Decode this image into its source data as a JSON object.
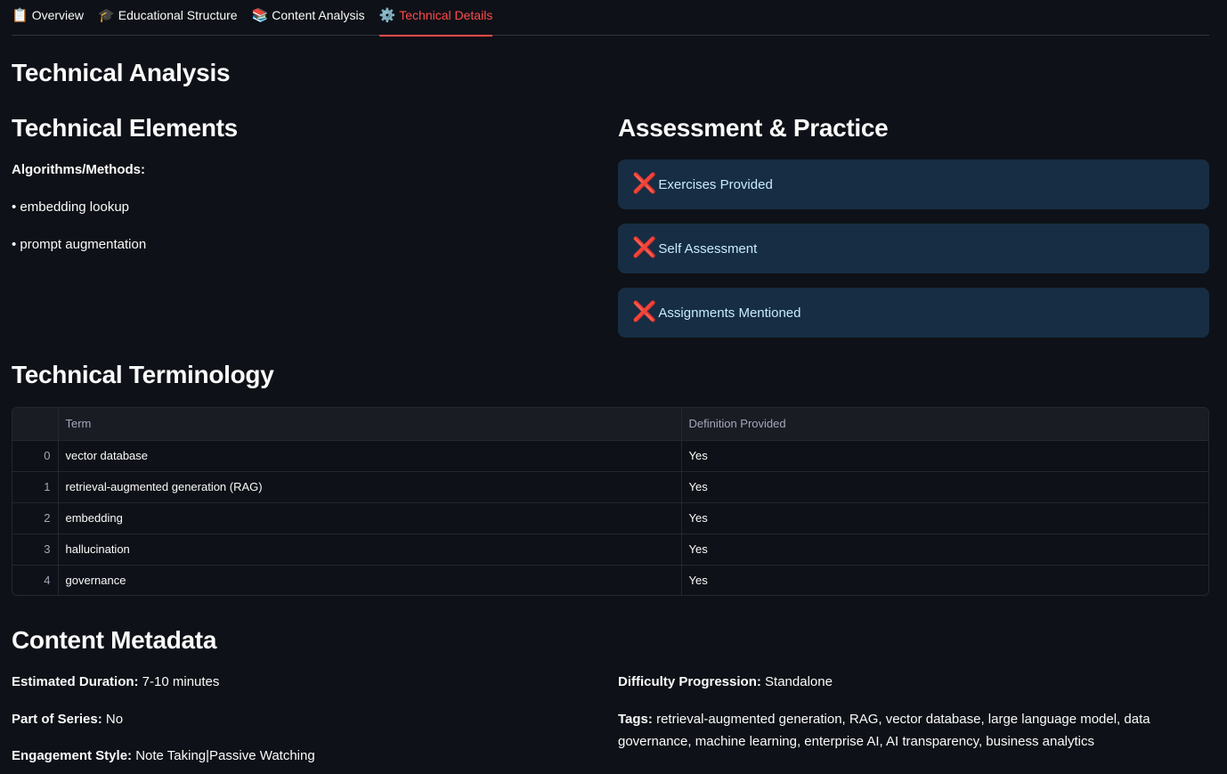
{
  "tabs": [
    {
      "icon": "📋",
      "icon_name": "clipboard-icon",
      "label": "Overview",
      "active": false
    },
    {
      "icon": "🎓",
      "icon_name": "graduation-cap-icon",
      "label": "Educational Structure",
      "active": false
    },
    {
      "icon": "📚",
      "icon_name": "books-icon",
      "label": "Content Analysis",
      "active": false
    },
    {
      "icon": "⚙️",
      "icon_name": "gear-icon",
      "label": "Technical Details",
      "active": true
    }
  ],
  "page_title": "Technical Analysis",
  "technical_elements": {
    "heading": "Technical Elements",
    "label": "Algorithms/Methods:",
    "items": [
      "• embedding lookup",
      "• prompt augmentation"
    ]
  },
  "assessment": {
    "heading": "Assessment & Practice",
    "icon": "❌",
    "items": [
      "Exercises Provided",
      "Self Assessment",
      "Assignments Mentioned"
    ]
  },
  "terminology": {
    "heading": "Technical Terminology",
    "columns": [
      "",
      "Term",
      "Definition Provided"
    ],
    "rows": [
      {
        "index": "0",
        "term": "vector database",
        "definition": "Yes"
      },
      {
        "index": "1",
        "term": "retrieval-augmented generation (RAG)",
        "definition": "Yes"
      },
      {
        "index": "2",
        "term": "embedding",
        "definition": "Yes"
      },
      {
        "index": "3",
        "term": "hallucination",
        "definition": "Yes"
      },
      {
        "index": "4",
        "term": "governance",
        "definition": "Yes"
      }
    ]
  },
  "metadata": {
    "heading": "Content Metadata",
    "duration_label": "Estimated Duration:",
    "duration_value": " 7-10 minutes",
    "series_label": "Part of Series:",
    "series_value": " No",
    "engagement_label": "Engagement Style:",
    "engagement_value": " Note Taking|Passive Watching",
    "difficulty_label": "Difficulty Progression:",
    "difficulty_value": " Standalone",
    "tags_label": "Tags:",
    "tags_line1": " retrieval-augmented generation, RAG, vector database, large language model, data",
    "tags_line2": "governance, machine learning, enterprise AI, AI transparency, business analytics"
  },
  "colors": {
    "background": "#0e1117",
    "accent": "#ff4b4b",
    "info_bg": "#172d43",
    "info_text": "#c7ebff",
    "error_icon": "#e0161b"
  }
}
